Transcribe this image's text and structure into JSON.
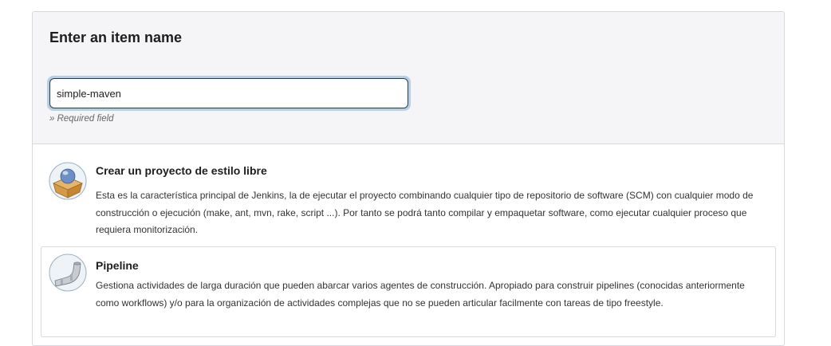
{
  "form": {
    "title": "Enter an item name",
    "item_name_value": "simple-maven",
    "required_note": "» Required field"
  },
  "item_types": [
    {
      "label": "Crear un proyecto de estilo libre",
      "description": "Esta es la característica principal de Jenkins, la de ejecutar el proyecto combinando cualquier tipo de repositorio de software (SCM) con cualquier modo de construcción o ejecución (make, ant, mvn, rake, script ...). Por tanto se podrá tanto compilar y empaquetar software, como ejecutar cualquier proceso que requiera monitorización.",
      "icon": "freestyle-project-icon"
    },
    {
      "label": "Pipeline",
      "description": "Gestiona actividades de larga duración que pueden abarcar varios agentes de construcción. Apropiado para construir pipelines (conocidas anteriormente como workflows) y/o para la organización de actividades complejas que no se pueden articular facilmente con tareas de tipo freestyle.",
      "icon": "pipeline-icon"
    }
  ],
  "colors": {
    "focus_ring": "#b8cfe0",
    "input_border": "#1f3d5a",
    "header_bg": "#f5f5f7"
  }
}
